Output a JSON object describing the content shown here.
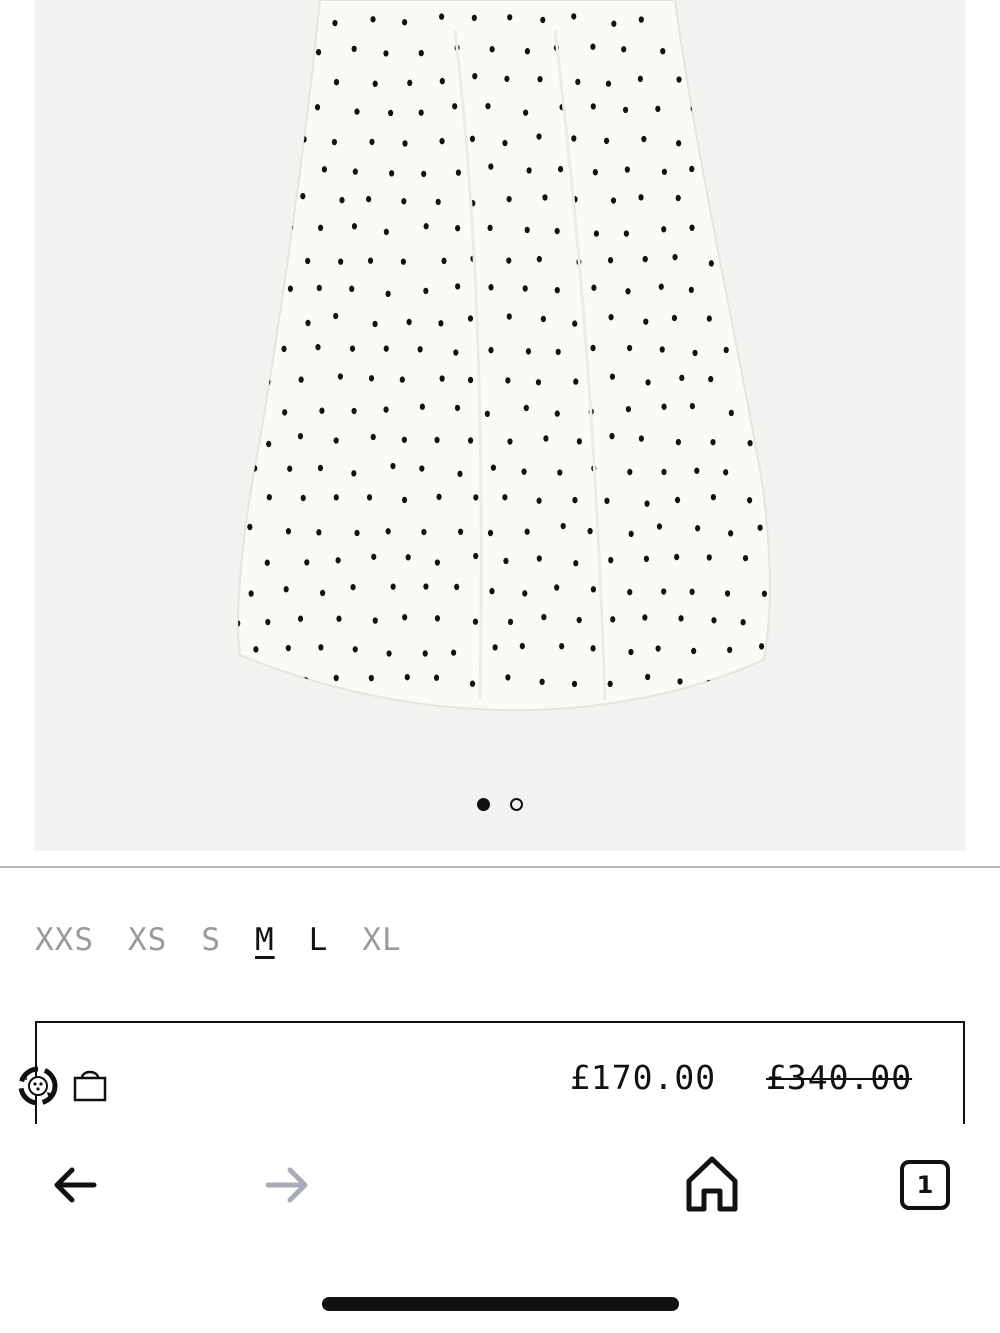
{
  "product": {
    "image_alt": "white skirt with black polka dots",
    "carousel": {
      "count": 2,
      "active_index": 0
    }
  },
  "sizes": [
    {
      "label": "XXS",
      "state": "unavailable"
    },
    {
      "label": "XS",
      "state": "unavailable"
    },
    {
      "label": "S",
      "state": "unavailable"
    },
    {
      "label": "M",
      "state": "selected"
    },
    {
      "label": "L",
      "state": "available"
    },
    {
      "label": "XL",
      "state": "unavailable"
    }
  ],
  "cart": {
    "sale_price": "£170.00",
    "original_price": "£340.00",
    "icons": [
      "recycle-badge-icon",
      "shopping-bag-icon"
    ]
  },
  "browser": {
    "tab_count": "1",
    "icons": [
      "back-arrow-icon",
      "forward-arrow-icon",
      "home-icon",
      "tabs-icon"
    ]
  },
  "colors": {
    "image_background": "#f3f2f0",
    "text": "#111111",
    "muted_text": "#9a9a9a",
    "divider": "#b9b9b4",
    "disabled_icon": "#a9acb8"
  }
}
